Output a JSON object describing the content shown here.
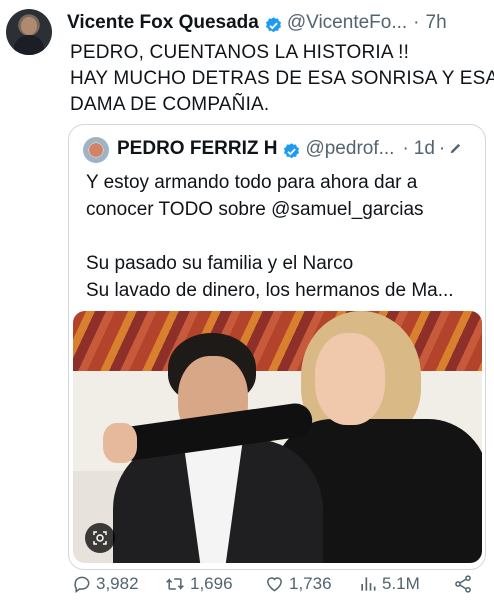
{
  "tweet": {
    "name": "Vicente Fox Quesada",
    "handle": "@VicenteFo...",
    "dot": "·",
    "time": "7h",
    "lines": [
      "PEDRO, CUENTANOS LA HISTORIA !!",
      "HAY MUCHO DETRAS DE ESA SONRISA Y ESA",
      "DAMA DE COMPAÑIA."
    ]
  },
  "quote": {
    "name": "PEDRO FERRIZ H",
    "handle": "@pedrof...",
    "dot": "·",
    "time": "1d",
    "dot2": "·",
    "lines": [
      "Y estoy armando todo para ahora dar a",
      "conocer TODO sobre @samuel_garcias",
      "Su pasado su familia y  el Narco",
      "Su lavado de dinero, los hermanos de Ma..."
    ]
  },
  "actions": {
    "replies": "3,982",
    "retweets": "1,696",
    "likes": "1,736",
    "views": "5.1M"
  },
  "colors": {
    "verified": "#1d9bf0",
    "secondary": "#536471"
  },
  "icons": [
    "verified-badge-icon",
    "pencil-icon",
    "lens-icon",
    "reply-icon",
    "retweet-icon",
    "like-icon",
    "views-icon",
    "share-icon"
  ]
}
